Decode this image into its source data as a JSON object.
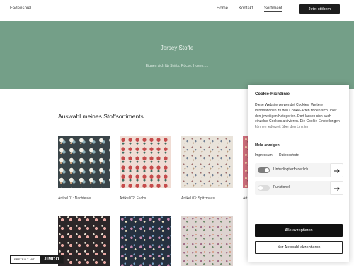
{
  "header": {
    "brand": "Fadenspiel",
    "nav": [
      "Home",
      "Kontakt",
      "Sortiment"
    ],
    "cta_label": "Jetzt stöbern"
  },
  "hero": {
    "title": "Jersey Stoffe",
    "subtitle": "Eignen sich für Shirts, Röcke, Hosen, ..."
  },
  "section": {
    "title": "Auswahl meines Stoffsortiments",
    "products": [
      {
        "caption": "Artikel 01: Nachteule"
      },
      {
        "caption": "Artikel 02: Fuchs"
      },
      {
        "caption": "Artikel 03: Spitzmaus"
      },
      {
        "caption": "Art"
      }
    ]
  },
  "badge": {
    "left": "ERSTELLT MIT",
    "right": "JIMDO"
  },
  "cookie": {
    "title": "Cookie-Richtlinie",
    "text": "Diese Website verwendet Cookies. Weitere Informationen zu den Cookie-Arten finden sich unter den jeweiligen Kategorien. Dort lassen sich auch einzelne Cookies aktivieren. Die Cookie-Einstellungen können jederzeit über den Link im",
    "more": "Mehr anzeigen",
    "links": [
      "Impressum",
      "Datenschutz"
    ],
    "rows": [
      {
        "label": "Unbedingt erforderlich",
        "enabled": true
      },
      {
        "label": "Funktionell",
        "enabled": false
      }
    ],
    "accept_all": "Alle akzeptieren",
    "accept_selection": "Nur Auswahl akzeptieren"
  }
}
